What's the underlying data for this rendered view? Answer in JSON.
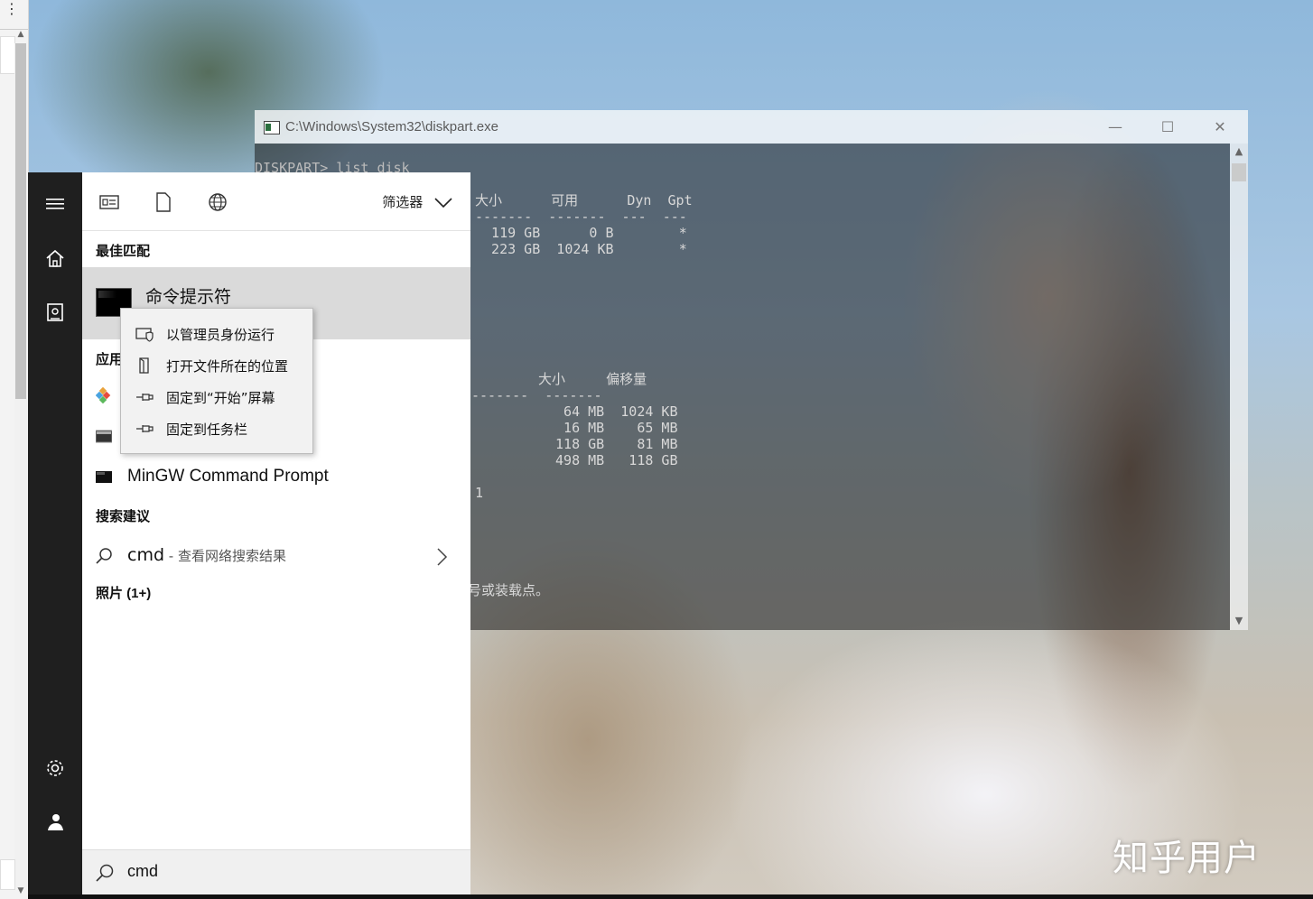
{
  "console": {
    "title": "C:\\Windows\\System32\\diskpart.exe",
    "controls": {
      "minimize": "—",
      "maximize": "☐",
      "close": "✕"
    },
    "lines": [
      "DISKPART> list disk",
      "大小      可用      Dyn  Gpt",
      "-------  -------  ---  ---",
      "  119 GB      0 B        *",
      "  223 GB  1024 KB        *",
      "大小     偏移量",
      "-------  -------",
      "  64 MB  1024 KB",
      "  16 MB    65 MB",
      " 118 GB    81 MB",
      " 498 MB   118 GB",
      "1",
      "号或装载点。"
    ]
  },
  "start_menu": {
    "rail": {
      "menu_icon": "hamburger-icon",
      "home_icon": "home-icon",
      "docs_icon": "document-icon",
      "settings_icon": "gear-icon",
      "user_icon": "user-icon"
    },
    "tabs": {
      "filter_label": "筛选器"
    },
    "sections": {
      "best_match": "最佳匹配",
      "apps": "应用",
      "search_suggestions": "搜索建议",
      "photos": "照片 (1+)"
    },
    "best_match_item": {
      "label": "命令提示符"
    },
    "apps": [
      {
        "label": "",
        "icon": "git-icon"
      },
      {
        "label": "",
        "icon": "console-icon"
      },
      {
        "label": "MinGW Command Prompt",
        "icon": "terminal-icon"
      }
    ],
    "suggestion": {
      "query": "cmd",
      "sub": " - 查看网络搜索结果"
    },
    "search_box": {
      "value": "cmd"
    }
  },
  "context_menu": {
    "items": [
      {
        "label": "以管理员身份运行",
        "icon": "shield-icon"
      },
      {
        "label": "打开文件所在的位置",
        "icon": "folder-icon"
      },
      {
        "label": "固定到“开始”屏幕",
        "icon": "pin-icon"
      },
      {
        "label": "固定到任务栏",
        "icon": "pin-icon"
      }
    ]
  },
  "watermark": "知乎用户"
}
